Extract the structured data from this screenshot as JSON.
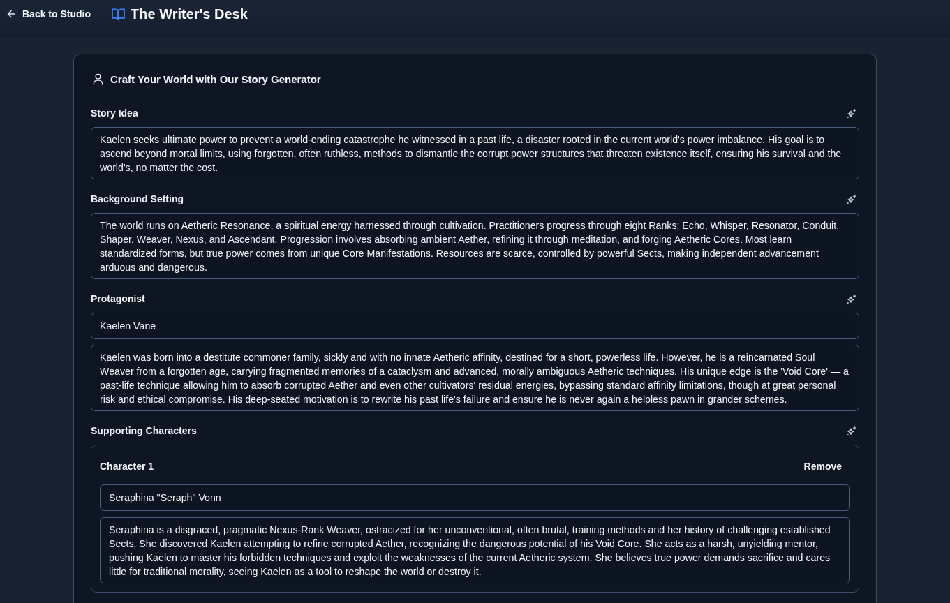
{
  "header": {
    "back_link": "Back to Studio",
    "title": "The Writer's Desk"
  },
  "generator": {
    "title": "Craft Your World with Our Story Generator",
    "sections": [
      {
        "kind": "text",
        "label": "Story Idea",
        "value": "Kaelen seeks ultimate power to prevent a world-ending catastrophe he witnessed in a past life, a disaster rooted in the current world's power imbalance. His goal is to ascend beyond mortal limits, using forgotten, often ruthless, methods to dismantle the corrupt power structures that threaten existence itself, ensuring his survival and the world's, no matter the cost."
      },
      {
        "kind": "text",
        "label": "Background Setting",
        "value": "The world runs on Aetheric Resonance, a spiritual energy harnessed through cultivation. Practitioners progress through eight Ranks: Echo, Whisper, Resonator, Conduit, Shaper, Weaver, Nexus, and Ascendant. Progression involves absorbing ambient Aether, refining it through meditation, and forging Aetheric Cores. Most learn standardized forms, but true power comes from unique Core Manifestations. Resources are scarce, controlled by powerful Sects, making independent advancement arduous and dangerous."
      },
      {
        "kind": "character",
        "label": "Protagonist",
        "name": "Kaelen Vane",
        "description": "Kaelen was born into a destitute commoner family, sickly and with no innate Aetheric affinity, destined for a short, powerless life. However, he is a reincarnated Soul Weaver from a forgotten age, carrying fragmented memories of a cataclysm and advanced, morally ambiguous Aetheric techniques. His unique edge is the 'Void Core' — a past-life technique allowing him to absorb corrupted Aether and even other cultivators' residual energies, bypassing standard affinity limitations, though at great personal risk and ethical compromise. His deep-seated motivation is to rewrite his past life's failure and ensure he is never again a helpless pawn in grander schemes."
      },
      {
        "kind": "list",
        "label": "Supporting Characters",
        "characters": [
          {
            "heading": "Character 1",
            "remove": "Remove",
            "name": "Seraphina \"Seraph\" Vonn",
            "description": "Seraphina is a disgraced, pragmatic Nexus-Rank Weaver, ostracized for her unconventional, often brutal, training methods and her history of challenging established Sects. She discovered Kaelen attempting to refine corrupted Aether, recognizing the dangerous potential of his Void Core. She acts as a harsh, unyielding mentor, pushing Kaelen to master his forbidden techniques and exploit the weaknesses of the current Aetheric system. She believes true power demands sacrifice and cares little for traditional morality, seeing Kaelen as a tool to reshape the world or destroy it."
          }
        ]
      }
    ]
  }
}
